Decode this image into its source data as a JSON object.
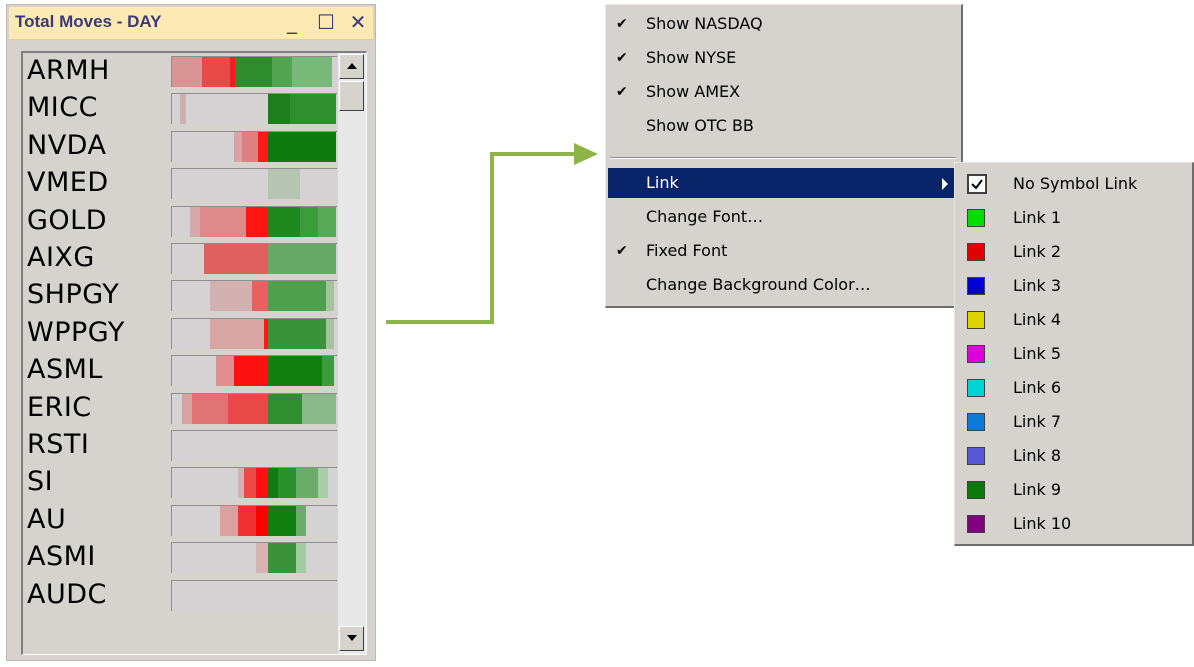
{
  "window": {
    "title": "Total Moves - DAY",
    "buttons": {
      "minimize": "_",
      "maximize": "☐",
      "close": "✕"
    }
  },
  "rows": [
    {
      "symbol": "ARMH",
      "segments": [
        [
          "#d99595",
          0,
          30
        ],
        [
          "#e84a4a",
          30,
          58
        ],
        [
          "#f02020",
          58,
          63
        ],
        [
          "#2e8b2e",
          63,
          100
        ],
        [
          "#52a452",
          100,
          120
        ],
        [
          "#78b878",
          120,
          160
        ]
      ]
    },
    {
      "symbol": "MICC",
      "segments": [
        [
          "#cfb0b0",
          8,
          14
        ],
        [
          "#1e7e1e",
          96,
          118
        ],
        [
          "#2f8f2f",
          118,
          164
        ]
      ]
    },
    {
      "symbol": "NVDA",
      "segments": [
        [
          "#d9a3a3",
          62,
          70
        ],
        [
          "#e07f7f",
          70,
          86
        ],
        [
          "#ff1a1a",
          86,
          96
        ],
        [
          "#0f7a0f",
          96,
          164
        ]
      ]
    },
    {
      "symbol": "VMED",
      "segments": [
        [
          "#b7c4b3",
          96,
          128
        ]
      ]
    },
    {
      "symbol": "GOLD",
      "segments": [
        [
          "#d8a9a9",
          18,
          28
        ],
        [
          "#dd8a8a",
          28,
          74
        ],
        [
          "#ff1414",
          74,
          96
        ],
        [
          "#1f881f",
          96,
          128
        ],
        [
          "#3c9c3c",
          128,
          146
        ],
        [
          "#58a858",
          146,
          164
        ]
      ]
    },
    {
      "symbol": "AIXG",
      "segments": [
        [
          "#e06060",
          32,
          96
        ],
        [
          "#66a866",
          96,
          164
        ]
      ]
    },
    {
      "symbol": "SHPGY",
      "segments": [
        [
          "#d4b1b1",
          38,
          80
        ],
        [
          "#e86060",
          80,
          96
        ],
        [
          "#4ea04e",
          96,
          154
        ],
        [
          "#a4c4a0",
          154,
          162
        ]
      ]
    },
    {
      "symbol": "WPPGY",
      "segments": [
        [
          "#d8a5a5",
          38,
          92
        ],
        [
          "#ff1a1a",
          92,
          96
        ],
        [
          "#3a923a",
          96,
          154
        ],
        [
          "#a4c4a0",
          154,
          162
        ]
      ]
    },
    {
      "symbol": "ASML",
      "segments": [
        [
          "#e08e8e",
          44,
          62
        ],
        [
          "#ff1010",
          62,
          96
        ],
        [
          "#118011",
          96,
          150
        ],
        [
          "#3c9c3c",
          150,
          162
        ]
      ]
    },
    {
      "symbol": "ERIC",
      "segments": [
        [
          "#d8a2a2",
          10,
          20
        ],
        [
          "#e07474",
          20,
          56
        ],
        [
          "#e84848",
          56,
          96
        ],
        [
          "#2f8f2f",
          96,
          130
        ],
        [
          "#8ab88a",
          130,
          164
        ]
      ]
    },
    {
      "symbol": "RSTI",
      "segments": []
    },
    {
      "symbol": "SI",
      "segments": [
        [
          "#d8b0b0",
          66,
          72
        ],
        [
          "#ee4848",
          72,
          84
        ],
        [
          "#ff1010",
          84,
          96
        ],
        [
          "#0e7c0e",
          96,
          106
        ],
        [
          "#2a902a",
          106,
          124
        ],
        [
          "#6aad6a",
          124,
          146
        ],
        [
          "#a9cda9",
          146,
          156
        ]
      ]
    },
    {
      "symbol": "AU",
      "segments": [
        [
          "#dca0a0",
          48,
          66
        ],
        [
          "#f03030",
          66,
          84
        ],
        [
          "#ff0000",
          84,
          96
        ],
        [
          "#118011",
          96,
          124
        ],
        [
          "#6aad6a",
          124,
          134
        ]
      ]
    },
    {
      "symbol": "ASMI",
      "segments": [
        [
          "#d8b2b2",
          84,
          96
        ],
        [
          "#3a923a",
          96,
          124
        ],
        [
          "#a4cca4",
          124,
          134
        ]
      ]
    },
    {
      "symbol": "AUDC",
      "segments": []
    }
  ],
  "menu": {
    "items": [
      {
        "label": "Show NASDAQ",
        "checked": true
      },
      {
        "label": "Show NYSE",
        "checked": true
      },
      {
        "label": "Show AMEX",
        "checked": true
      },
      {
        "label": "Show OTC BB",
        "checked": false
      }
    ],
    "items2": [
      {
        "label": "Link",
        "checked": false,
        "submenu": true,
        "highlighted": true
      },
      {
        "label": "Change Font…",
        "checked": false
      },
      {
        "label": "Fixed Font",
        "checked": true
      },
      {
        "label": "Change Background Color…",
        "checked": false
      }
    ],
    "check_glyph": "✔"
  },
  "submenu": {
    "items": [
      {
        "label": "No Symbol Link",
        "color": null,
        "checked": true
      },
      {
        "label": "Link 1",
        "color": "#00dd00"
      },
      {
        "label": "Link 2",
        "color": "#e00000"
      },
      {
        "label": "Link 3",
        "color": "#0000d8"
      },
      {
        "label": "Link 4",
        "color": "#dcd400"
      },
      {
        "label": "Link 5",
        "color": "#dc00dc"
      },
      {
        "label": "Link 6",
        "color": "#00d4d4"
      },
      {
        "label": "Link 7",
        "color": "#0a7ad6"
      },
      {
        "label": "Link 8",
        "color": "#5658d6"
      },
      {
        "label": "Link 9",
        "color": "#0a780a"
      },
      {
        "label": "Link 10",
        "color": "#800080"
      }
    ]
  },
  "colors": {
    "arrow": "#8db447",
    "highlight": "#0a246a",
    "titlebar": "#fde9b4"
  }
}
